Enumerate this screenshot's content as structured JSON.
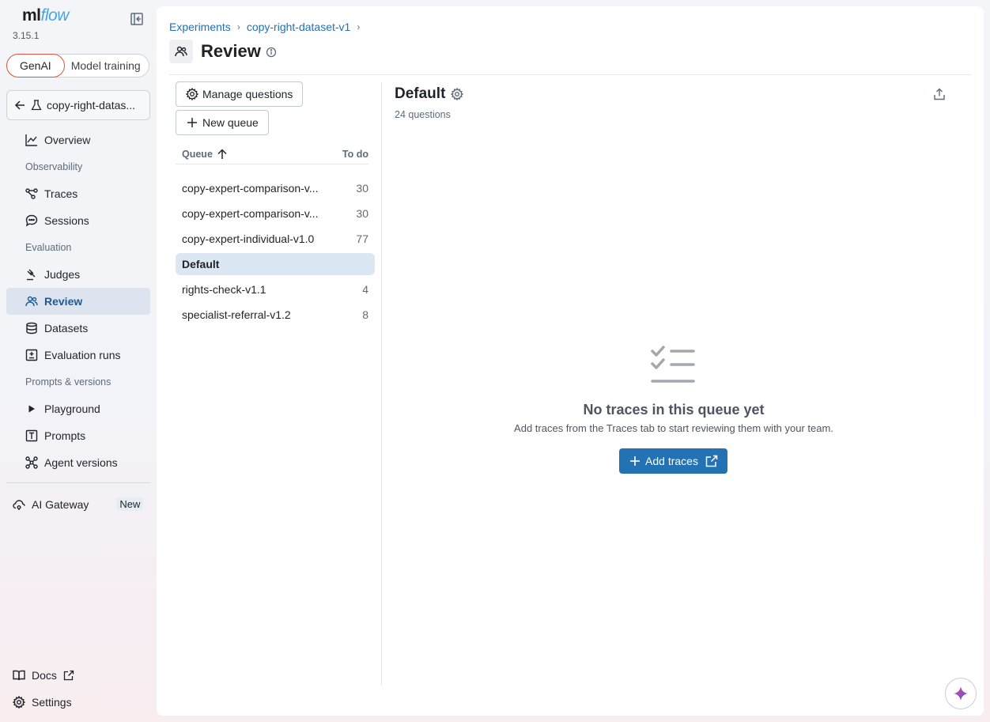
{
  "app": {
    "logo_ml": "ml",
    "logo_flow": "flow",
    "version": "3.15.1"
  },
  "mode_toggle": {
    "genai": "GenAI",
    "model_training": "Model training"
  },
  "experiment_selector": {
    "label": "copy-right-datas..."
  },
  "sidebar": {
    "overview": "Overview",
    "section_observability": "Observability",
    "traces": "Traces",
    "sessions": "Sessions",
    "section_evaluation": "Evaluation",
    "judges": "Judges",
    "review": "Review",
    "datasets": "Datasets",
    "evaluation_runs": "Evaluation runs",
    "section_prompts": "Prompts & versions",
    "playground": "Playground",
    "prompts": "Prompts",
    "agent_versions": "Agent versions",
    "ai_gateway": "AI Gateway",
    "new_badge": "New",
    "docs": "Docs",
    "settings": "Settings"
  },
  "breadcrumb": {
    "experiments": "Experiments",
    "experiment": "copy-right-dataset-v1"
  },
  "page": {
    "title": "Review"
  },
  "toolbar": {
    "manage_questions": "Manage questions",
    "new_queue": "New queue"
  },
  "queue_table": {
    "col_queue": "Queue",
    "col_todo": "To do",
    "rows": [
      {
        "name": "copy-expert-comparison-v...",
        "count": "30"
      },
      {
        "name": "copy-expert-comparison-v...",
        "count": "30"
      },
      {
        "name": "copy-expert-individual-v1.0",
        "count": "77"
      },
      {
        "name": "Default",
        "count": ""
      },
      {
        "name": "rights-check-v1.1",
        "count": "4"
      },
      {
        "name": "specialist-referral-v1.2",
        "count": "8"
      }
    ]
  },
  "detail": {
    "title": "Default",
    "subtitle": "24 questions",
    "empty_title": "No traces in this queue yet",
    "empty_desc": "Add traces from the Traces tab to start reviewing them with your team.",
    "add_traces": "Add traces"
  },
  "colors": {
    "accent": "#2272b4",
    "active_nav_bg": "#dde4ef",
    "selected_row_bg": "#dbe8f3",
    "genai_border": "#e2533d"
  }
}
